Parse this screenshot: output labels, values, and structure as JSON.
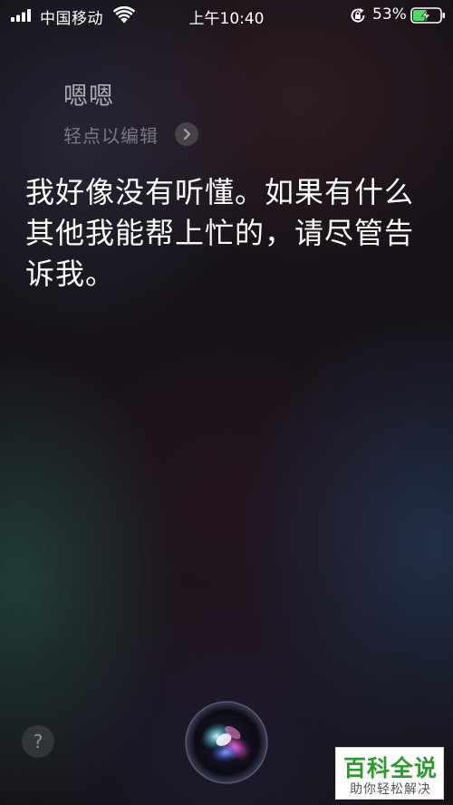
{
  "status_bar": {
    "carrier": "中国移动",
    "time": "上午10:40",
    "battery_percent": "53%",
    "battery_level": 0.53,
    "charging": true,
    "signal_bars": 4,
    "icons": [
      "signal-icon",
      "wifi-icon",
      "rotation-lock-icon",
      "battery-icon"
    ]
  },
  "siri": {
    "query": "嗯嗯",
    "edit_hint": "轻点以编辑",
    "response": "我好像没有听懂。如果有什么其他我能帮上忙的，请尽管告诉我。",
    "help_label": "?"
  },
  "watermark": {
    "title": "百科全说",
    "subtitle": "助你轻松解决"
  },
  "colors": {
    "battery_charging": "#4cd964",
    "watermark_green": "#2c9a2c"
  }
}
